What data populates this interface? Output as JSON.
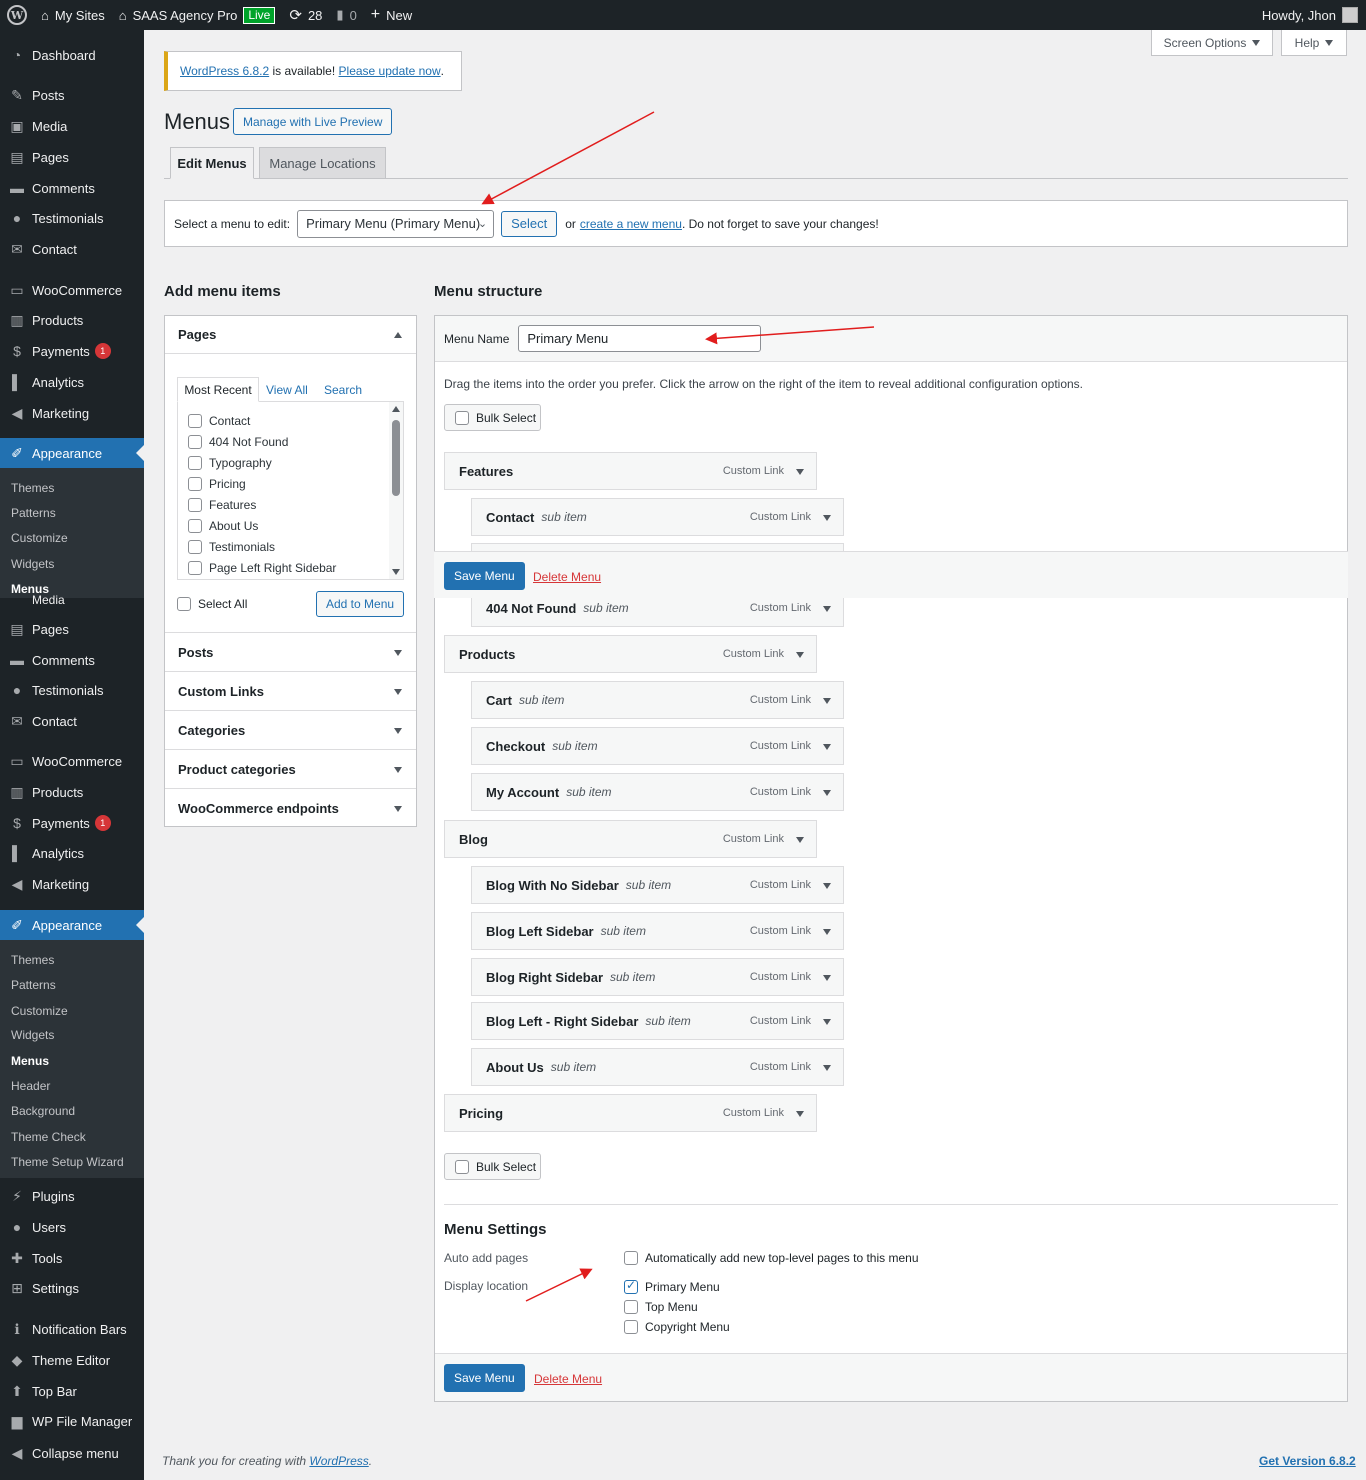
{
  "adminbar": {
    "my_sites": "My Sites",
    "site_name": "SAAS Agency Pro",
    "live": "Live",
    "updates": "28",
    "comments": "0",
    "new": "New",
    "howdy": "Howdy, Jhon"
  },
  "sidebar": {
    "items": [
      {
        "label": "Dashboard",
        "icon": "dashboard-icon"
      },
      {
        "label": "Posts",
        "icon": "pin-icon"
      },
      {
        "label": "Media",
        "icon": "media-icon"
      },
      {
        "label": "Pages",
        "icon": "pages-icon"
      },
      {
        "label": "Comments",
        "icon": "comment-icon"
      },
      {
        "label": "Testimonials",
        "icon": "user-icon"
      },
      {
        "label": "Contact",
        "icon": "mail-icon"
      },
      {
        "label": "WooCommerce",
        "icon": "woo-icon"
      },
      {
        "label": "Products",
        "icon": "archive-icon"
      },
      {
        "label": "Payments",
        "icon": "payment-icon",
        "badge": "1"
      },
      {
        "label": "Analytics",
        "icon": "chart-icon"
      },
      {
        "label": "Marketing",
        "icon": "megaphone-icon"
      },
      {
        "label": "Appearance",
        "icon": "brush-icon"
      }
    ],
    "submenu1": [
      "Themes",
      "Patterns",
      "Customize",
      "Widgets",
      "Menus"
    ],
    "overlap_text": "Media",
    "items2": [
      {
        "label": "Pages",
        "icon": "pages-icon"
      },
      {
        "label": "Comments",
        "icon": "comment-icon"
      },
      {
        "label": "Testimonials",
        "icon": "user-icon"
      },
      {
        "label": "Contact",
        "icon": "mail-icon"
      },
      {
        "label": "WooCommerce",
        "icon": "woo-icon"
      },
      {
        "label": "Products",
        "icon": "archive-icon"
      },
      {
        "label": "Payments",
        "icon": "payment-icon",
        "badge": "1"
      },
      {
        "label": "Analytics",
        "icon": "chart-icon"
      },
      {
        "label": "Marketing",
        "icon": "megaphone-icon"
      },
      {
        "label": "Appearance",
        "icon": "brush-icon"
      }
    ],
    "submenu2": [
      "Themes",
      "Patterns",
      "Customize",
      "Widgets",
      "Menus",
      "Header",
      "Background",
      "Theme Check",
      "Theme Setup Wizard"
    ],
    "items3": [
      {
        "label": "Plugins",
        "icon": "plugin-icon"
      },
      {
        "label": "Users",
        "icon": "users-icon"
      },
      {
        "label": "Tools",
        "icon": "wrench-icon"
      },
      {
        "label": "Settings",
        "icon": "settings-icon"
      },
      {
        "label": "Notification Bars",
        "icon": "info-icon"
      },
      {
        "label": "Theme Editor",
        "icon": "editor-icon"
      },
      {
        "label": "Top Bar",
        "icon": "topbar-icon"
      },
      {
        "label": "WP File Manager",
        "icon": "folder-icon"
      },
      {
        "label": "Collapse menu",
        "icon": "collapse-icon"
      }
    ]
  },
  "top_buttons": {
    "screen_options": "Screen Options",
    "help": "Help"
  },
  "notice": {
    "link1": "WordPress 6.8.2",
    "text": " is available! ",
    "link2": "Please update now",
    "end": "."
  },
  "page": {
    "title": "Menus",
    "live_preview": "Manage with Live Preview"
  },
  "tabs": {
    "edit": "Edit Menus",
    "locations": "Manage Locations"
  },
  "select_bar": {
    "label": "Select a menu to edit:",
    "selected": "Primary Menu (Primary Menu)",
    "select_btn": "Select",
    "or": "or",
    "create_link": "create a new menu",
    "tail": ". Do not forget to save your changes!"
  },
  "add_items": {
    "heading": "Add menu items",
    "pages_title": "Pages",
    "tabs": [
      "Most Recent",
      "View All",
      "Search"
    ],
    "pages": [
      "Contact",
      "404 Not Found",
      "Typography",
      "Pricing",
      "Features",
      "About Us",
      "Testimonials",
      "Page Left Right Sidebar"
    ],
    "select_all": "Select All",
    "add_btn": "Add to Menu",
    "sections": [
      "Posts",
      "Custom Links",
      "Categories",
      "Product categories",
      "WooCommerce endpoints"
    ]
  },
  "structure": {
    "heading": "Menu structure",
    "name_label": "Menu Name",
    "name_value": "Primary Menu",
    "instructions": "Drag the items into the order you prefer. Click the arrow on the right of the item to reveal additional configuration options.",
    "bulk_select": "Bulk Select",
    "type_label": "Custom Link",
    "sub_label": "sub item",
    "save": "Save Menu",
    "delete": "Delete Menu",
    "items": [
      {
        "title": "Features",
        "sub": false
      },
      {
        "title": "Contact",
        "sub": true
      },
      {
        "title": "404 Not Found",
        "sub": true
      },
      {
        "title": "Products",
        "sub": false
      },
      {
        "title": "Cart",
        "sub": true
      },
      {
        "title": "Checkout",
        "sub": true
      },
      {
        "title": "My Account",
        "sub": true
      },
      {
        "title": "Blog",
        "sub": false
      },
      {
        "title": "Blog With No Sidebar",
        "sub": true
      },
      {
        "title": "Blog Left Sidebar",
        "sub": true
      },
      {
        "title": "Blog Right Sidebar",
        "sub": true
      },
      {
        "title": "Blog Left - Right Sidebar",
        "sub": true
      },
      {
        "title": "About Us",
        "sub": true
      },
      {
        "title": "Pricing",
        "sub": false
      }
    ]
  },
  "settings": {
    "heading": "Menu Settings",
    "auto_label": "Auto add pages",
    "auto_option": "Automatically add new top-level pages to this menu",
    "location_label": "Display location",
    "locations": [
      {
        "label": "Primary Menu",
        "checked": true
      },
      {
        "label": "Top Menu",
        "checked": false
      },
      {
        "label": "Copyright Menu",
        "checked": false
      }
    ]
  },
  "footer": {
    "thanks": "Thank you for creating with ",
    "wp_link": "WordPress",
    "end": ".",
    "version": "Get Version 6.8.2"
  },
  "colors": {
    "accent": "#2271b1",
    "sidebar": "#1d2327",
    "arrow": "#e11d1d",
    "delete": "#d63638"
  }
}
